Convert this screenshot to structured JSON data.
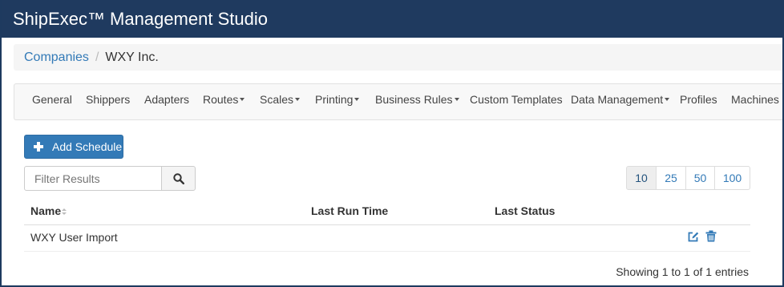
{
  "app": {
    "title": "ShipExec™ Management Studio"
  },
  "breadcrumb": {
    "parent": "Companies",
    "separator": "/",
    "current": "WXY Inc."
  },
  "nav": {
    "items": [
      {
        "label": "General"
      },
      {
        "label": "Shippers"
      },
      {
        "label": "Adapters"
      },
      {
        "label": "Routes",
        "dropdown": true
      },
      {
        "label": "Scales",
        "dropdown": true
      },
      {
        "label": "Printing",
        "dropdown": true
      },
      {
        "label": "Business Rules",
        "dropdown": true
      },
      {
        "label": "Custom Templates"
      },
      {
        "label": "Data Management",
        "dropdown": true
      },
      {
        "label": "Profiles"
      },
      {
        "label": "Machines"
      }
    ]
  },
  "toolbar": {
    "add_label": "Add Schedule",
    "filter_placeholder": "Filter Results"
  },
  "pager": {
    "sizes": [
      "10",
      "25",
      "50",
      "100"
    ],
    "selected": "10"
  },
  "table": {
    "headers": {
      "name": "Name",
      "last_run": "Last Run Time",
      "last_status": "Last Status"
    },
    "rows": [
      {
        "name": "WXY User Import",
        "last_run": "",
        "last_status": ""
      }
    ]
  },
  "footer": {
    "summary": "Showing 1 to 1 of 1 entries"
  },
  "colors": {
    "title_bar": "#1f3a5f",
    "primary": "#337ab7",
    "link": "#337ab7"
  }
}
